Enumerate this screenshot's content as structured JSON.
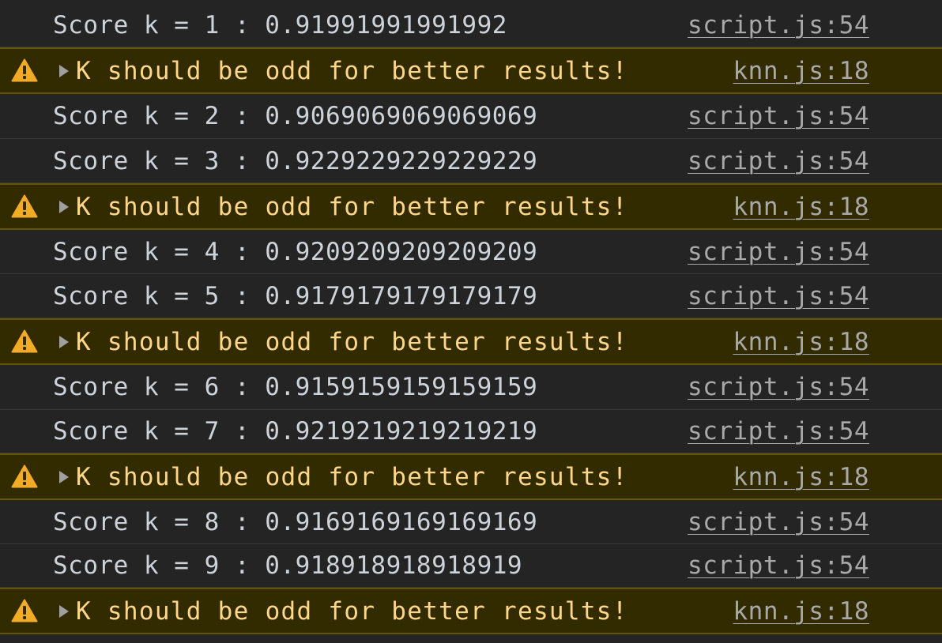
{
  "colors": {
    "background": "#242424",
    "log_text": "#cdd3d9",
    "warning_background": "#332b00",
    "warning_border": "#665500",
    "warning_text": "#ffd78a",
    "warning_icon": "#f2ab26",
    "source_link": "#a9a9a9"
  },
  "icons": {
    "warning": "warning-triangle-icon",
    "expand": "caret-right-icon"
  },
  "rows": [
    {
      "type": "log",
      "text": "Score k = 1 : 0.91991991991992",
      "source": "script.js:54"
    },
    {
      "type": "warn",
      "text": "K should be odd for better results!",
      "source": "knn.js:18"
    },
    {
      "type": "log",
      "text": "Score k = 2 : 0.9069069069069069",
      "source": "script.js:54"
    },
    {
      "type": "log",
      "text": "Score k = 3 : 0.9229229229229229",
      "source": "script.js:54"
    },
    {
      "type": "warn",
      "text": "K should be odd for better results!",
      "source": "knn.js:18"
    },
    {
      "type": "log",
      "text": "Score k = 4 : 0.9209209209209209",
      "source": "script.js:54"
    },
    {
      "type": "log",
      "text": "Score k = 5 : 0.9179179179179179",
      "source": "script.js:54"
    },
    {
      "type": "warn",
      "text": "K should be odd for better results!",
      "source": "knn.js:18"
    },
    {
      "type": "log",
      "text": "Score k = 6 : 0.9159159159159159",
      "source": "script.js:54"
    },
    {
      "type": "log",
      "text": "Score k = 7 : 0.9219219219219219",
      "source": "script.js:54"
    },
    {
      "type": "warn",
      "text": "K should be odd for better results!",
      "source": "knn.js:18"
    },
    {
      "type": "log",
      "text": "Score k = 8 : 0.9169169169169169",
      "source": "script.js:54"
    },
    {
      "type": "log",
      "text": "Score k = 9 : 0.918918918918919",
      "source": "script.js:54"
    },
    {
      "type": "warn",
      "text": "K should be odd for better results!",
      "source": "knn.js:18"
    }
  ]
}
